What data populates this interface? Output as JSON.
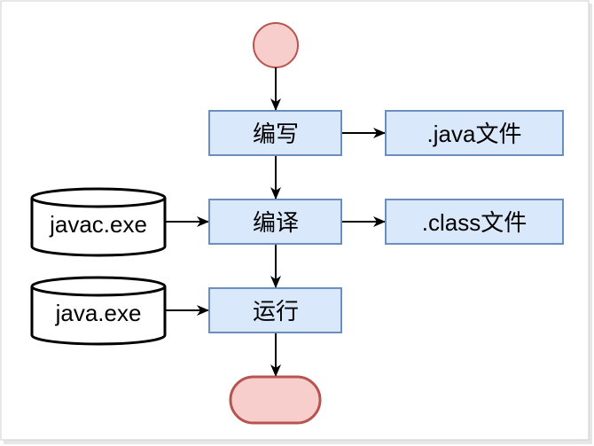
{
  "nodes": {
    "write": "编写",
    "java_file": ".java文件",
    "compile": "编译",
    "class_file": ".class文件",
    "run": "运行",
    "javac": "javac.exe",
    "java": "java.exe"
  },
  "colors": {
    "process_fill": "#dae8fc",
    "process_stroke": "#6c8ebf",
    "terminal_fill": "#f8cecc",
    "terminal_stroke": "#b85450",
    "storage_stroke": "#000000"
  }
}
